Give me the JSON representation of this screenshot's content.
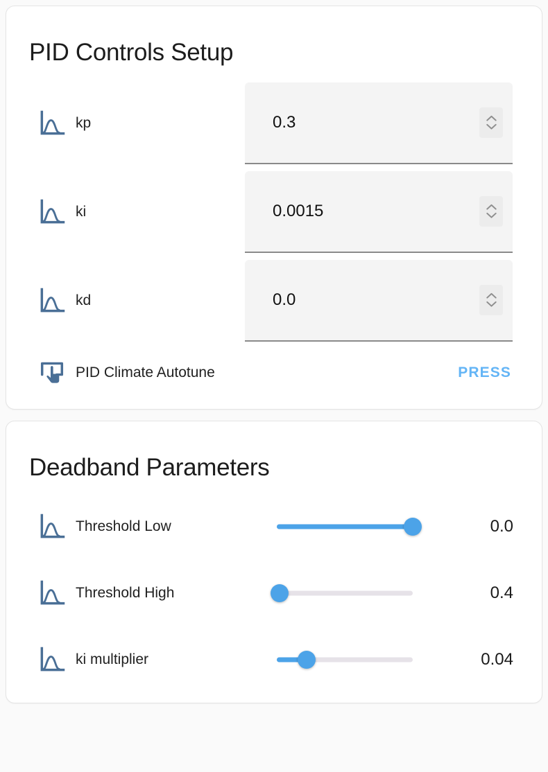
{
  "pid_card": {
    "title": "PID Controls Setup",
    "number_fields": [
      {
        "icon": "chart-bell-curve-icon",
        "label": "kp",
        "value": "0.3"
      },
      {
        "icon": "chart-bell-curve-icon",
        "label": "ki",
        "value": "0.0015"
      },
      {
        "icon": "chart-bell-curve-icon",
        "label": "kd",
        "value": "0.0"
      }
    ],
    "action_row": {
      "icon": "touch-app-icon",
      "label": "PID Climate Autotune",
      "button_label": "PRESS"
    }
  },
  "deadband_card": {
    "title": "Deadband Parameters",
    "sliders": [
      {
        "icon": "chart-bell-curve-icon",
        "label": "Threshold Low",
        "value": "0.0",
        "percent": 100
      },
      {
        "icon": "chart-bell-curve-icon",
        "label": "Threshold High",
        "value": "0.4",
        "percent": 2
      },
      {
        "icon": "chart-bell-curve-icon",
        "label": "ki multiplier",
        "value": "0.04",
        "percent": 22
      }
    ]
  },
  "colors": {
    "accent_blue": "#4ca3e8",
    "press_blue": "#64b5f6",
    "icon_blue": "#4a6f96",
    "track_gray": "#e6e2e8",
    "card_bg": "#ffffff",
    "page_bg": "#fafafa",
    "input_bg": "#f4f4f4"
  }
}
